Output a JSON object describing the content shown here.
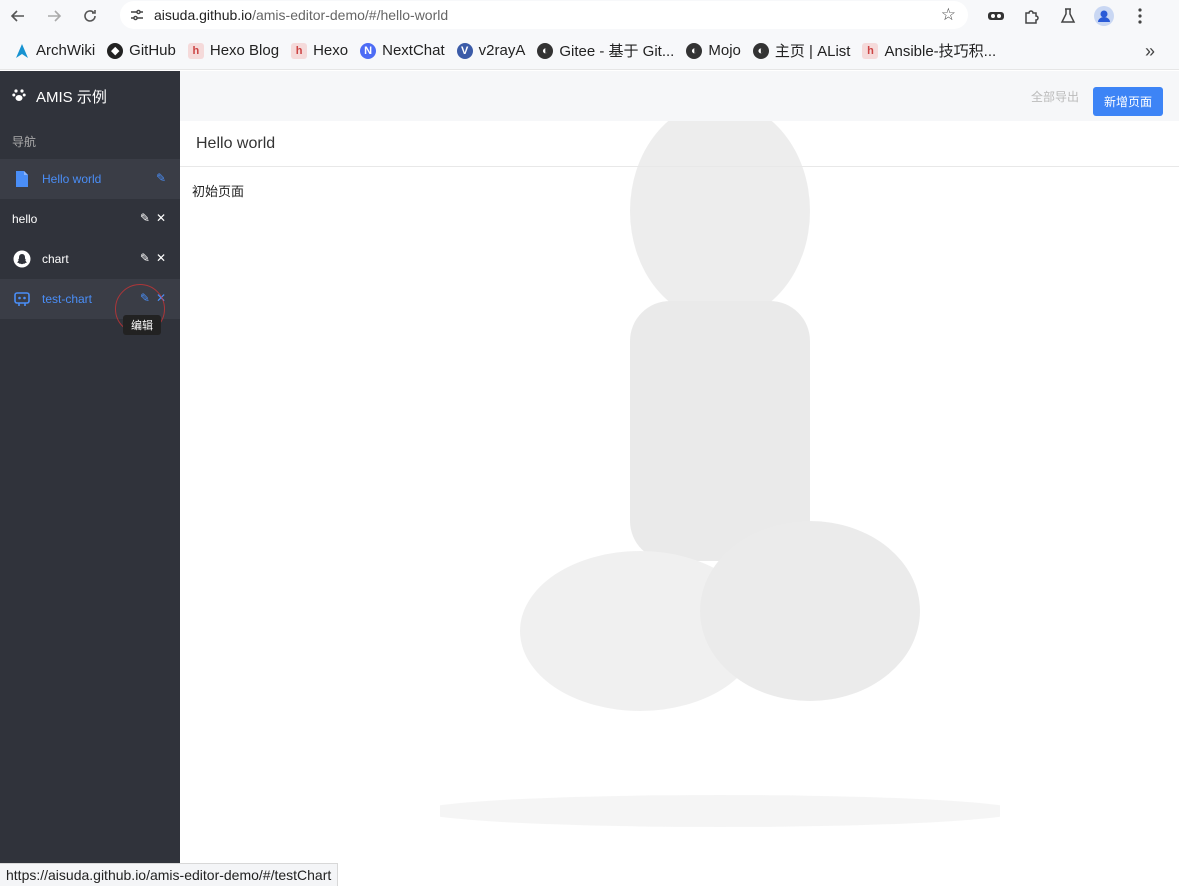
{
  "browser": {
    "url_host": "aisuda.github.io",
    "url_path": "/amis-editor-demo/#/hello-world",
    "bookmarks": [
      {
        "label": "ArchWiki",
        "icon": "archlinux-icon",
        "color": "#1793d1"
      },
      {
        "label": "GitHub",
        "icon": "github-icon",
        "color": "#222222"
      },
      {
        "label": "Hexo Blog",
        "icon": "hexo-icon",
        "color": "#f0d0d0"
      },
      {
        "label": "Hexo",
        "icon": "hexo-icon",
        "color": "#f0d0d0"
      },
      {
        "label": "NextChat",
        "icon": "nextchat-icon",
        "color": "#4d6cf5"
      },
      {
        "label": "v2rayA",
        "icon": "v2raya-icon",
        "color": "#3b5ba8"
      },
      {
        "label": "Gitee - 基于 Git...",
        "icon": "globe-icon",
        "color": "#333333"
      },
      {
        "label": "Mojo",
        "icon": "globe-icon",
        "color": "#333333"
      },
      {
        "label": "主页 | AList",
        "icon": "globe-icon",
        "color": "#333333"
      },
      {
        "label": "Ansible-技巧积...",
        "icon": "hexo-icon",
        "color": "#f0d0d0"
      }
    ],
    "status_url": "https://aisuda.github.io/amis-editor-demo/#/testChart"
  },
  "app": {
    "brand": "AMIS 示例",
    "nav_title": "导航",
    "nav_items": [
      {
        "label": "Hello world",
        "icon": "file-icon",
        "active": true
      },
      {
        "label": "hello",
        "icon": "",
        "active": false
      },
      {
        "label": "chart",
        "icon": "snapchat-icon",
        "active": false
      },
      {
        "label": "test-chart",
        "icon": "robot-icon",
        "active": true
      }
    ],
    "tooltip": "编辑",
    "export_label": "全部导出",
    "new_page_label": "新增页面",
    "page_title": "Hello world",
    "page_body": "初始页面",
    "accent_color": "#3d84f6"
  }
}
